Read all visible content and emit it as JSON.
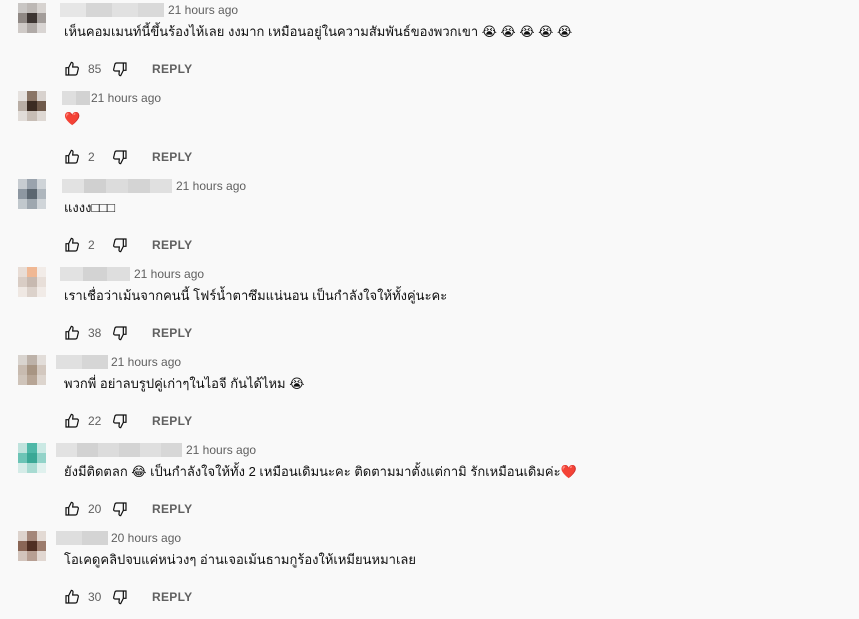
{
  "reply_label": "REPLY",
  "comments": [
    {
      "time": "21 hours ago",
      "text": "เห็นคอมเมนท์นี้ขึ้นร้องไห้เลย งงมาก เหมือนอยู่ในความสัมพันธ์ของพวกเขา 😭 😭 😭 😭 😭",
      "likes": "85"
    },
    {
      "time": "21 hours ago",
      "text": "❤️",
      "likes": "2"
    },
    {
      "time": "21 hours ago",
      "text": "แงงง□□□",
      "likes": "2"
    },
    {
      "time": "21 hours ago",
      "text": "เราเชื่อว่าเม้นจากคนนี้ โฟร์น้ำตาซึมแน่นอน เป็นกำลังใจให้ทั้งคู่นะคะ",
      "likes": "38"
    },
    {
      "time": "21 hours ago",
      "text": "พวกพี่ อย่าลบรูปคู่เก่าๆในไอจี กันได้ไหม 😭",
      "likes": "22"
    },
    {
      "time": "21 hours ago",
      "text": "ยังมีติดตลก 😂 เป็นกำลังใจให้ทั้ง 2 เหมือนเดิมนะคะ ติดตามมาตั้งแต่กามิ รักเหมือนเดิมค่ะ❤️",
      "likes": "20"
    },
    {
      "time": "20 hours ago",
      "text": "โอเคดูคลิปจบแค่หน่วงๆ อ่านเจอเม้นธามกูร้องให้เหมียนหมาเลย",
      "likes": "30"
    }
  ],
  "icons": {
    "like": "thumbs-up-icon",
    "dislike": "thumbs-down-icon"
  },
  "colors": {
    "background": "#f9f9f9",
    "text": "#0f0f0f",
    "secondary": "#606060"
  }
}
